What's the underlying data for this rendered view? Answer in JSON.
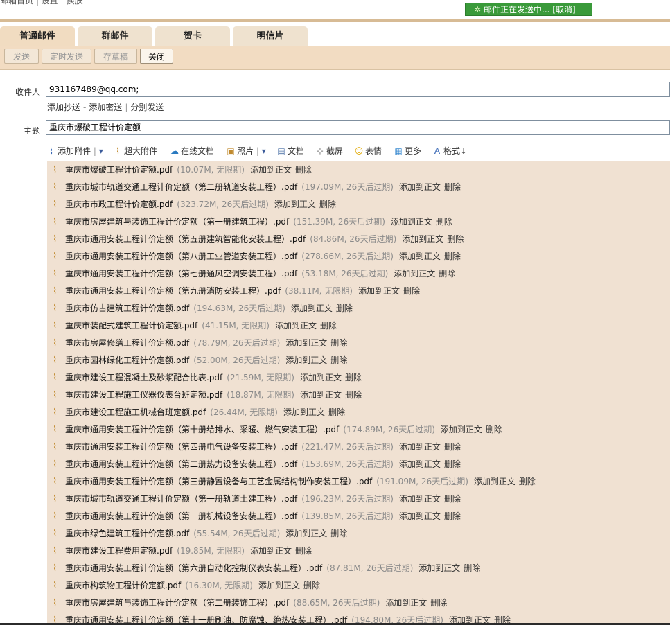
{
  "breadcrumb": "邮箱首页 | 设置 - 换肤",
  "sending_status": {
    "text": "邮件正在发送中... [取消]"
  },
  "tabs": [
    {
      "label": "普通邮件",
      "active": true
    },
    {
      "label": "群邮件",
      "active": false
    },
    {
      "label": "贺卡",
      "active": false
    },
    {
      "label": "明信片",
      "active": false
    }
  ],
  "toolbar": {
    "send": "发送",
    "timed_send": "定时发送",
    "save_draft": "存草稿",
    "close": "关闭"
  },
  "compose": {
    "to_label": "收件人",
    "to_value": "931167489@qq.com;",
    "add_cc": "添加抄送",
    "add_bcc": "添加密送",
    "separate_send": "分别发送",
    "subject_label": "主题",
    "subject_value": "重庆市爆破工程计价定额"
  },
  "attach_tools": {
    "add_attachment": "添加附件",
    "big_attachment": "超大附件",
    "online_doc": "在线文档",
    "photo": "照片",
    "document": "文档",
    "screenshot": "截屏",
    "emoji": "表情",
    "more": "更多",
    "format": "格式"
  },
  "attachment_actions": {
    "add_to_body": "添加到正文",
    "delete": "删除"
  },
  "attachments": [
    {
      "name": "重庆市爆破工程计价定额.pdf",
      "meta": "(10.07M, 无限期)"
    },
    {
      "name": "重庆市城市轨道交通工程计价定额（第二册轨道安装工程）.pdf",
      "meta": "(197.09M, 26天后过期)"
    },
    {
      "name": "重庆市市政工程计价定额.pdf",
      "meta": "(323.72M, 26天后过期)"
    },
    {
      "name": "重庆市房屋建筑与装饰工程计价定额（第一册建筑工程）.pdf",
      "meta": "(151.39M, 26天后过期)"
    },
    {
      "name": "重庆市通用安装工程计价定额（第五册建筑智能化安装工程）.pdf",
      "meta": "(84.86M, 26天后过期)"
    },
    {
      "name": "重庆市通用安装工程计价定额（第八册工业管道安装工程）.pdf",
      "meta": "(278.66M, 26天后过期)"
    },
    {
      "name": "重庆市通用安装工程计价定额（第七册通风空调安装工程）.pdf",
      "meta": "(53.18M, 26天后过期)"
    },
    {
      "name": "重庆市通用安装工程计价定额（第九册消防安装工程）.pdf",
      "meta": "(38.11M, 无限期)"
    },
    {
      "name": "重庆市仿古建筑工程计价定额.pdf",
      "meta": "(194.63M, 26天后过期)"
    },
    {
      "name": "重庆市装配式建筑工程计价定额.pdf",
      "meta": "(41.15M, 无限期)"
    },
    {
      "name": "重庆市房屋修缮工程计价定额.pdf",
      "meta": "(78.79M, 26天后过期)"
    },
    {
      "name": "重庆市园林绿化工程计价定额.pdf",
      "meta": "(52.00M, 26天后过期)"
    },
    {
      "name": "重庆市建设工程混凝土及砂浆配合比表.pdf",
      "meta": "(21.59M, 无限期)"
    },
    {
      "name": "重庆市建设工程施工仪器仪表台班定额.pdf",
      "meta": "(18.87M, 无限期)"
    },
    {
      "name": "重庆市建设工程施工机械台班定额.pdf",
      "meta": "(26.44M, 无限期)"
    },
    {
      "name": "重庆市通用安装工程计价定额（第十册给排水、采暖、燃气安装工程）.pdf",
      "meta": "(174.89M, 26天后过期)"
    },
    {
      "name": "重庆市通用安装工程计价定额（第四册电气设备安装工程）.pdf",
      "meta": "(221.47M, 26天后过期)"
    },
    {
      "name": "重庆市通用安装工程计价定额（第二册热力设备安装工程）.pdf",
      "meta": "(153.69M, 26天后过期)"
    },
    {
      "name": "重庆市通用安装工程计价定额（第三册静置设备与工艺金属结构制作安装工程）.pdf",
      "meta": "(191.09M, 26天后过期)"
    },
    {
      "name": "重庆市城市轨道交通工程计价定额（第一册轨道土建工程）.pdf",
      "meta": "(196.23M, 26天后过期)"
    },
    {
      "name": "重庆市通用安装工程计价定额（第一册机械设备安装工程）.pdf",
      "meta": "(139.85M, 26天后过期)"
    },
    {
      "name": "重庆市绿色建筑工程计价定额.pdf",
      "meta": "(55.54M, 26天后过期)"
    },
    {
      "name": "重庆市建设工程费用定额.pdf",
      "meta": "(19.85M, 无限期)"
    },
    {
      "name": "重庆市通用安装工程计价定额（第六册自动化控制仪表安装工程）.pdf",
      "meta": "(87.81M, 26天后过期)"
    },
    {
      "name": "重庆市构筑物工程计价定额.pdf",
      "meta": "(16.30M, 无限期)"
    },
    {
      "name": "重庆市房屋建筑与装饰工程计价定额（第二册装饰工程）.pdf",
      "meta": "(88.65M, 26天后过期)"
    },
    {
      "name": "重庆市通用安装工程计价定额（第十一册刷油、防腐蚀、绝热安装工程）.pdf",
      "meta": "(194.80M, 26天后过期)"
    }
  ],
  "colors": {
    "accent": "#3a9a3a",
    "band": "#f2dcc2",
    "attachment_bg": "#f0e1d2"
  }
}
